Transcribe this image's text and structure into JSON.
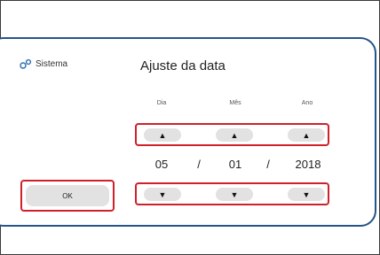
{
  "sidebar": {
    "system_label": "Sistema",
    "icon": "settings-gear-icon"
  },
  "dialog": {
    "title": "Ajuste da data",
    "columns": {
      "day": "Dia",
      "month": "Mês",
      "year": "Ano"
    },
    "values": {
      "day": "05",
      "month": "01",
      "year": "2018"
    },
    "separator": "/",
    "up_glyph": "▲",
    "down_glyph": "▼"
  },
  "ok_label": "OK",
  "colors": {
    "panel_border": "#24548a",
    "highlight": "#d0212a",
    "button_bg": "#e2e2e2"
  }
}
